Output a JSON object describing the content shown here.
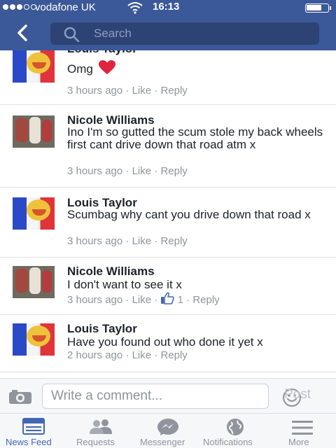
{
  "status_bar": {
    "carrier": "vodafone UK",
    "time": "16:13",
    "signal_bars_filled": 3,
    "signal_bars_total": 5,
    "battery_level": 0.75
  },
  "nav": {
    "search_placeholder": "Search"
  },
  "comments": [
    {
      "author": "Louis Taylor",
      "text": "Omg",
      "time": "3 hours ago",
      "like": "Like",
      "reply": "Reply",
      "sep": "·",
      "has_heart": true,
      "avatar": "french-flag-emoji"
    },
    {
      "author": "Nicole Williams",
      "text": "Ino I'm so gutted the scum stole my back wheels first cant drive down that road atm x",
      "time": "3 hours ago",
      "like": "Like",
      "reply": "Reply",
      "sep": "·",
      "avatar": "photo"
    },
    {
      "author": "Louis Taylor",
      "text": "Scumbag why cant you drive down that road x",
      "time": "3 hours ago",
      "like": "Like",
      "reply": "Reply",
      "sep": "·",
      "avatar": "french-flag-emoji"
    },
    {
      "author": "Nicole Williams",
      "text": "I don't want to see it x",
      "time": "3 hours ago",
      "like": "Like",
      "reply": "Reply",
      "sep": "·",
      "like_count": "1",
      "avatar": "photo"
    },
    {
      "author": "Louis Taylor",
      "text": "Have you found out who done it yet x",
      "time": "2 hours ago",
      "like": "Like",
      "reply": "Reply",
      "sep": "·",
      "avatar": "french-flag-emoji"
    }
  ],
  "composer": {
    "placeholder": "Write a comment...",
    "post_label": "Post"
  },
  "tabs": [
    {
      "label": "News Feed",
      "icon": "news-feed-icon",
      "active": true
    },
    {
      "label": "Requests",
      "icon": "friend-requests-icon"
    },
    {
      "label": "Messenger",
      "icon": "messenger-icon"
    },
    {
      "label": "Notifications",
      "icon": "globe-icon"
    },
    {
      "label": "More",
      "icon": "hamburger-icon"
    }
  ],
  "colors": {
    "brand": "#3b5998",
    "active_tab": "#4267b2",
    "meta_text": "#90949c",
    "heart": "#e0243b"
  }
}
